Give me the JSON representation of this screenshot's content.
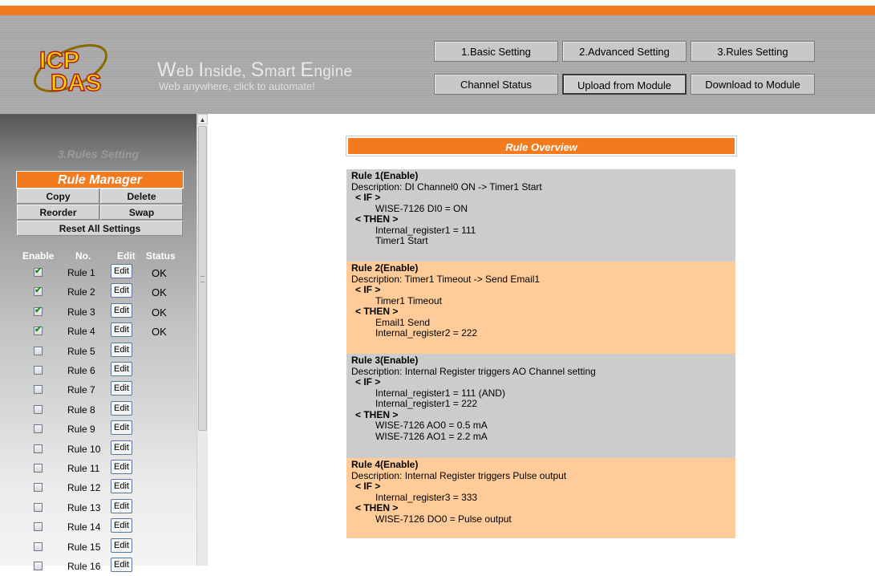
{
  "header": {
    "tagline_parts": [
      "W",
      "eb ",
      "I",
      "nside, ",
      "S",
      "mart ",
      "E",
      "ngine"
    ],
    "subtagline": "Web anywhere, click to automate!",
    "logo_text_top": "ICP",
    "logo_text_bottom": "DAS",
    "nav": {
      "basic": "1.Basic Setting",
      "advanced": "2.Advanced Setting",
      "rules": "3.Rules Setting",
      "channel_status": "Channel Status",
      "upload": "Upload from Module",
      "download": "Download to Module"
    }
  },
  "colors": {
    "accent": "#f47a20",
    "header_bg": "#a7a7a7",
    "rule_gray": "#cccccc",
    "rule_peach": "#ffcc99"
  },
  "sidebar": {
    "title": "3.Rules Setting",
    "manager_title": "Rule Manager",
    "buttons": {
      "copy": "Copy",
      "delete": "Delete",
      "reorder": "Reorder",
      "swap": "Swap",
      "reset": "Reset All Settings"
    },
    "columns": {
      "enable": "Enable",
      "no": "No.",
      "edit": "Edit",
      "status": "Status"
    },
    "edit_label": "Edit",
    "rules": [
      {
        "name": "Rule 1",
        "enabled": true,
        "status": "OK"
      },
      {
        "name": "Rule 2",
        "enabled": true,
        "status": "OK"
      },
      {
        "name": "Rule 3",
        "enabled": true,
        "status": "OK"
      },
      {
        "name": "Rule 4",
        "enabled": true,
        "status": "OK"
      },
      {
        "name": "Rule 5",
        "enabled": false,
        "status": ""
      },
      {
        "name": "Rule 6",
        "enabled": false,
        "status": ""
      },
      {
        "name": "Rule 7",
        "enabled": false,
        "status": ""
      },
      {
        "name": "Rule 8",
        "enabled": false,
        "status": ""
      },
      {
        "name": "Rule 9",
        "enabled": false,
        "status": ""
      },
      {
        "name": "Rule 10",
        "enabled": false,
        "status": ""
      },
      {
        "name": "Rule 11",
        "enabled": false,
        "status": ""
      },
      {
        "name": "Rule 12",
        "enabled": false,
        "status": ""
      },
      {
        "name": "Rule 13",
        "enabled": false,
        "status": ""
      },
      {
        "name": "Rule 14",
        "enabled": false,
        "status": ""
      },
      {
        "name": "Rule 15",
        "enabled": false,
        "status": ""
      },
      {
        "name": "Rule 16",
        "enabled": false,
        "status": ""
      }
    ]
  },
  "overview": {
    "title": "Rule Overview",
    "if_label": "< IF >",
    "then_label": "< THEN >",
    "rules": [
      {
        "title": "Rule 1(Enable)",
        "description": "Description: DI Channel0 ON -> Timer1 Start",
        "if": [
          "WISE-7126 DI0 = ON"
        ],
        "then": [
          "Internal_register1 = 111",
          "Timer1 Start"
        ]
      },
      {
        "title": "Rule 2(Enable)",
        "description": "Description: Timer1 Timeout -> Send Email1",
        "if": [
          "Timer1 Timeout"
        ],
        "then": [
          "Email1 Send",
          "Internal_register2 = 222"
        ]
      },
      {
        "title": "Rule 3(Enable)",
        "description": "Description: Internal Register triggers AO Channel setting",
        "if": [
          "Internal_register1 = 111 (AND)",
          "Internal_register1 = 222"
        ],
        "then": [
          "WISE-7126 AO0 = 0.5 mA",
          "WISE-7126 AO1 = 2.2 mA"
        ]
      },
      {
        "title": "Rule 4(Enable)",
        "description": "Description: Internal Register triggers Pulse output",
        "if": [
          "Internal_register3 = 333"
        ],
        "then": [
          "WISE-7126 DO0 = Pulse output"
        ]
      }
    ]
  }
}
